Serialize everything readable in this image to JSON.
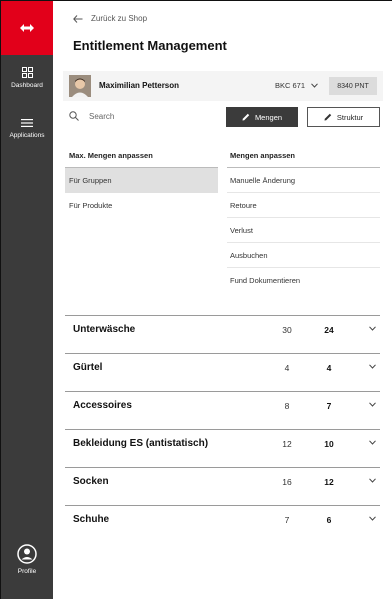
{
  "sidebar": {
    "items": [
      {
        "label": "Dashboard",
        "icon": "dashboard-icon"
      },
      {
        "label": "Applications",
        "icon": "menu-icon"
      },
      {
        "label": "Profile",
        "icon": "profile-icon"
      }
    ],
    "logo_color": "#e2001a"
  },
  "header": {
    "back_label": "Zurück zu Shop",
    "title": "Entitlement Management"
  },
  "user": {
    "name": "Maximilian Petterson",
    "cost_center": "BKC 671",
    "points": "8340 PNT"
  },
  "toolbar": {
    "search_placeholder": "Search",
    "mengen_label": "Mengen",
    "struktur_label": "Struktur"
  },
  "panels": {
    "left_header": "Max. Mengen anpassen",
    "left_items": [
      "Für Gruppen",
      "Für Produkte"
    ],
    "right_header": "Mengen anpassen",
    "right_items": [
      "Manuelle Änderung",
      "Retoure",
      "Verlust",
      "Ausbuchen",
      "Fund Dokumentieren"
    ]
  },
  "categories": [
    {
      "name": "Unterwäsche",
      "max": "30",
      "current": "24"
    },
    {
      "name": "Gürtel",
      "max": "4",
      "current": "4"
    },
    {
      "name": "Accessoires",
      "max": "8",
      "current": "7"
    },
    {
      "name": "Bekleidung ES (antistatisch)",
      "max": "12",
      "current": "10"
    },
    {
      "name": "Socken",
      "max": "16",
      "current": "12"
    },
    {
      "name": "Schuhe",
      "max": "7",
      "current": "6"
    }
  ]
}
